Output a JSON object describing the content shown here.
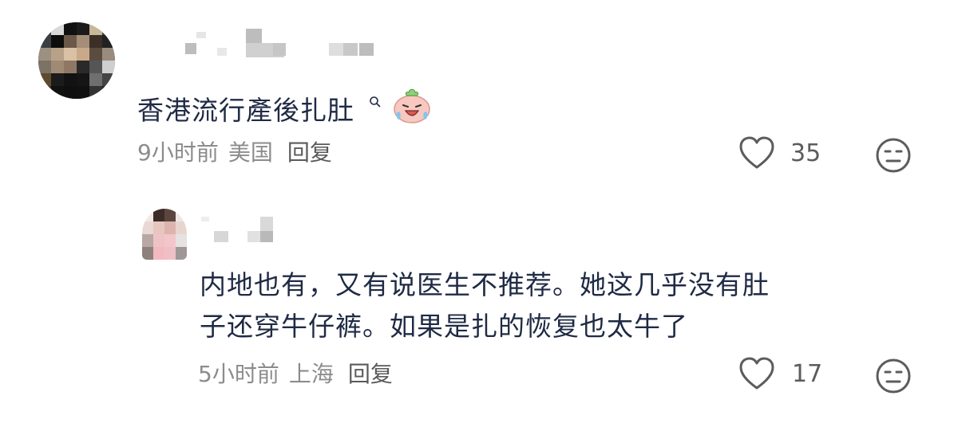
{
  "comments": [
    {
      "text": "香港流行產後扎肚",
      "meta": {
        "time": "9小时前",
        "location": "美国",
        "reply_label": "回复"
      },
      "likes": "35",
      "icons": {
        "avatar": "avatar-pixelated",
        "search": "search-icon",
        "emoji": "laughing-crying-emoji-icon",
        "like": "heart-outline-icon",
        "dislike": "meh-face-icon"
      }
    },
    {
      "text_line1": "内地也有，又有说医生不推荐。她这几乎没有肚",
      "text_line2": "子还穿牛仔裤。如果是扎的恢复也太牛了",
      "meta": {
        "time": "5小时前",
        "location": "上海",
        "reply_label": "回复"
      },
      "likes": "17",
      "icons": {
        "avatar": "avatar-pixelated",
        "like": "heart-outline-icon",
        "dislike": "meh-face-icon"
      }
    }
  ],
  "colors": {
    "comment_text": "#1f2a44",
    "meta_text": "#8c8c8c",
    "icon_stroke": "#5c5c5c"
  }
}
